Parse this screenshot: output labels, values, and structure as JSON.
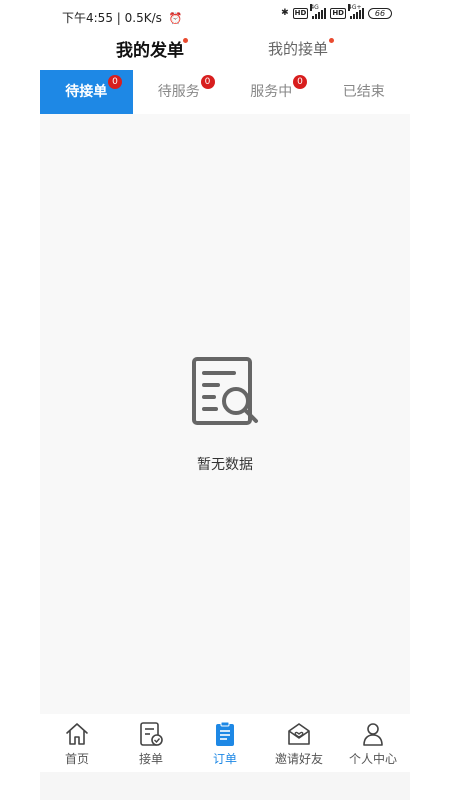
{
  "status_bar": {
    "time_speed": "下午4:55 | 0.5K/s",
    "alarm_icon": "alarm-icon",
    "hd1": "HD",
    "net1": "4G",
    "hd2": "HD",
    "net2": "4G+",
    "battery": "66"
  },
  "header": {
    "tabs": [
      {
        "label": "我的发单",
        "active": true,
        "dot": true
      },
      {
        "label": "我的接单",
        "active": false,
        "dot": true
      }
    ]
  },
  "order_tabs": [
    {
      "label": "待接单",
      "badge": "0",
      "active": true
    },
    {
      "label": "待服务",
      "badge": "0",
      "active": false
    },
    {
      "label": "服务中",
      "badge": "0",
      "active": false
    },
    {
      "label": "已结束",
      "active": false
    }
  ],
  "empty_state": {
    "icon": "document-search-icon",
    "text": "暂无数据"
  },
  "bottom_nav": [
    {
      "label": "首页",
      "icon": "home-icon",
      "active": false
    },
    {
      "label": "接单",
      "icon": "order-check-icon",
      "active": false
    },
    {
      "label": "订单",
      "icon": "clipboard-icon",
      "active": true
    },
    {
      "label": "邀请好友",
      "icon": "invite-heart-icon",
      "active": false
    },
    {
      "label": "个人中心",
      "icon": "person-icon",
      "active": false
    }
  ],
  "colors": {
    "accent": "#1e88e5",
    "badge": "#d81e1e",
    "dot": "#e94a2f",
    "content_bg": "#f8f8f8"
  }
}
